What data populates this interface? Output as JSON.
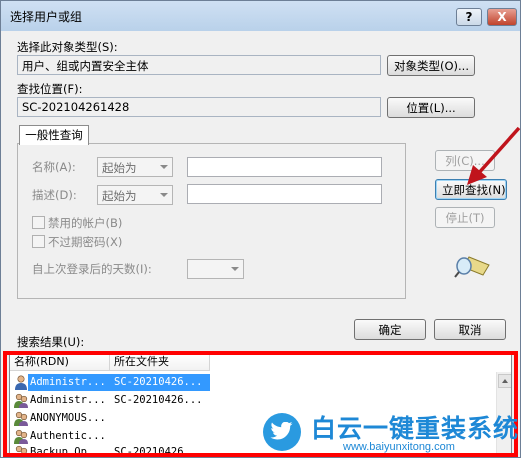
{
  "window": {
    "title": "选择用户或组",
    "help_label": "?",
    "close_label": "X"
  },
  "object_type": {
    "label": "选择此对象类型(S):",
    "value": "用户、组或内置安全主体",
    "button_label": "对象类型(O)..."
  },
  "location": {
    "label": "查找位置(F):",
    "value": "SC-202104261428",
    "button_label": "位置(L)..."
  },
  "general_query": {
    "tab_label": "一般性查询",
    "name_label": "名称(A):",
    "name_mode": "起始为",
    "description_label": "描述(D):",
    "description_mode": "起始为",
    "disabled_accounts_label": "禁用的帐户(B)",
    "non_expiring_password_label": "不过期密码(X)",
    "days_since_logon_label": "自上次登录后的天数(I):",
    "days_since_logon_value": ""
  },
  "actions": {
    "columns_label": "列(C)...",
    "find_now_label": "立即查找(N)",
    "stop_label": "停止(T)",
    "ok_label": "确定",
    "cancel_label": "取消"
  },
  "results": {
    "label": "搜索结果(U):",
    "columns": [
      "名称(RDN)",
      "所在文件夹"
    ],
    "rows": [
      {
        "name": "Administr...",
        "folder": "SC-20210426..."
      },
      {
        "name": "Administr...",
        "folder": "SC-20210426..."
      },
      {
        "name": "ANONYMOUS...",
        "folder": ""
      },
      {
        "name": "Authentic...",
        "folder": ""
      },
      {
        "name": "Backup Op...",
        "folder": "SC-20210426..."
      }
    ]
  },
  "watermark": {
    "text": "白云一键重装系统",
    "url": "www.baiyunxitong.com"
  },
  "colors": {
    "highlight": "#ff0000",
    "selection": "#3399ff",
    "watermark": "#1e88d6",
    "arrow": "#c0141c"
  }
}
